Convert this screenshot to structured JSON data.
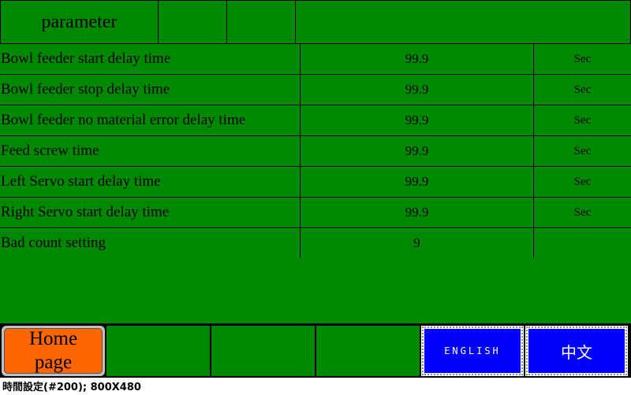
{
  "header": {
    "title": "parameter"
  },
  "rows": [
    {
      "label": "Bowl feeder start delay time",
      "value": "99.9",
      "unit": "Sec"
    },
    {
      "label": "Bowl feeder stop delay time",
      "value": "99.9",
      "unit": "Sec"
    },
    {
      "label": "Bowl feeder no material error delay time",
      "value": "99.9",
      "unit": "Sec"
    },
    {
      "label": "Feed screw time",
      "value": "99.9",
      "unit": "Sec"
    },
    {
      "label": "Left Servo start delay time",
      "value": "99.9",
      "unit": "Sec"
    },
    {
      "label": "Right Servo start delay time",
      "value": "99.9",
      "unit": "Sec"
    },
    {
      "label": "Bad count setting",
      "value": "9",
      "unit": ""
    }
  ],
  "footer": {
    "home_line1": "Home",
    "home_line2": "page",
    "english": "ENGLISH",
    "chinese": "中文"
  },
  "caption": "時間設定(#200); 800X480",
  "colors": {
    "background": "#008800",
    "home": "#ff6600",
    "lang": "#0000ff"
  }
}
